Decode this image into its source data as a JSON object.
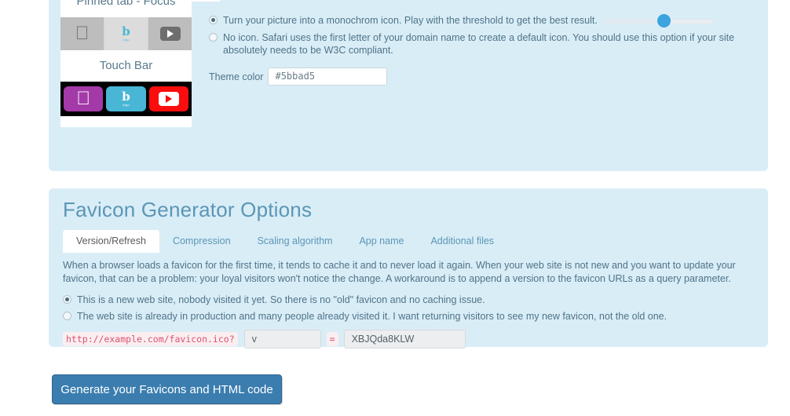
{
  "top_panel": {
    "preview": {
      "pinned_tab_caption": "Pinned tab - Focus",
      "touch_bar_caption": "Touch Bar",
      "icons": [
        "apple-icon",
        "logo-icon",
        "youtube-icon"
      ]
    },
    "options": [
      {
        "id": "monochrome",
        "selected": true,
        "label": "Turn your picture into a monochrom icon. Play with the threshold to get the best result.",
        "has_slider": true
      },
      {
        "id": "no-icon",
        "selected": false,
        "label": "No icon. Safari uses the first letter of your domain name to create a default icon. You should use this option if your site absolutely needs to be W3C compliant.",
        "has_slider": false
      }
    ],
    "theme_color": {
      "label": "Theme color",
      "value": "#5bbad5"
    }
  },
  "favicon_panel": {
    "title": "Favicon Generator Options",
    "tabs": [
      {
        "label": "Version/Refresh",
        "active": true
      },
      {
        "label": "Compression",
        "active": false
      },
      {
        "label": "Scaling algorithm",
        "active": false
      },
      {
        "label": "App name",
        "active": false
      },
      {
        "label": "Additional files",
        "active": false
      }
    ],
    "paragraph": "When a browser loads a favicon for the first time, it tends to cache it and to never load it again. When your web site is not new and you want to update your favicon, that can be a problem: your loyal visitors won't notice the change. A workaround is to append a version to the favicon URLs as a query parameter.",
    "options": [
      {
        "id": "new-site",
        "selected": true,
        "label": "This is a new web site, nobody visited it yet. So there is no \"old\" favicon and no caching issue."
      },
      {
        "id": "existing-site",
        "selected": false,
        "label": "The web site is already in production and many people already visited it. I want returning visitors to see my new favicon, not the old one."
      }
    ],
    "version_row": {
      "url_prefix": "http://example.com/favicon.ico?",
      "equals": "=",
      "key_value": "v",
      "value_value": "XBJQda8KLW"
    }
  },
  "generate_button": {
    "label": "Generate your Favicons and HTML code"
  },
  "colors": {
    "panel_bg": "#d9edf7",
    "title": "#5b96b5",
    "text": "#4f7387",
    "button": "#3b7daf",
    "slider_knob": "#3ba3dd",
    "code": "#d9536f",
    "theme_color": "#5bbad5"
  }
}
